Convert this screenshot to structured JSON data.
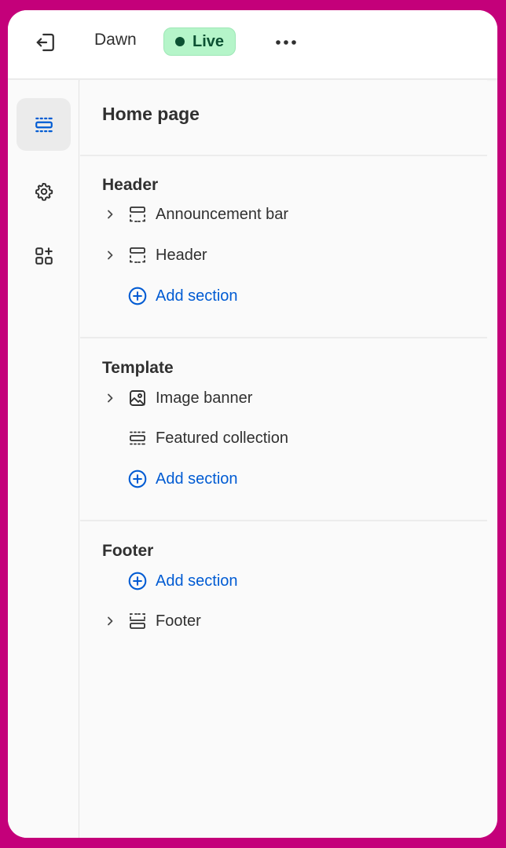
{
  "topbar": {
    "theme_name": "Dawn",
    "status_badge": "Live",
    "more_label": "•••"
  },
  "rail": {
    "items": [
      {
        "name": "sections",
        "icon": "sections-icon",
        "active": true
      },
      {
        "name": "settings",
        "icon": "gear-icon",
        "active": false
      },
      {
        "name": "apps",
        "icon": "apps-add-icon",
        "active": false
      }
    ]
  },
  "panel": {
    "title": "Home page",
    "groups": [
      {
        "title": "Header",
        "items": [
          {
            "label": "Announcement bar",
            "icon": "section-header-icon",
            "expandable": true
          },
          {
            "label": "Header",
            "icon": "section-header-icon",
            "expandable": true
          }
        ],
        "add_label": "Add section"
      },
      {
        "title": "Template",
        "items": [
          {
            "label": "Image banner",
            "icon": "image-icon",
            "expandable": true
          },
          {
            "label": "Featured collection",
            "icon": "section-icon",
            "expandable": false
          }
        ],
        "add_label": "Add section"
      },
      {
        "title": "Footer",
        "add_label": "Add section",
        "items": [
          {
            "label": "Footer",
            "icon": "section-footer-icon",
            "expandable": true
          }
        ]
      }
    ]
  },
  "colors": {
    "frame_border": "#c4007a",
    "accent": "#005bd3",
    "live_bg": "#b5f5c9",
    "live_text": "#0c5132"
  }
}
